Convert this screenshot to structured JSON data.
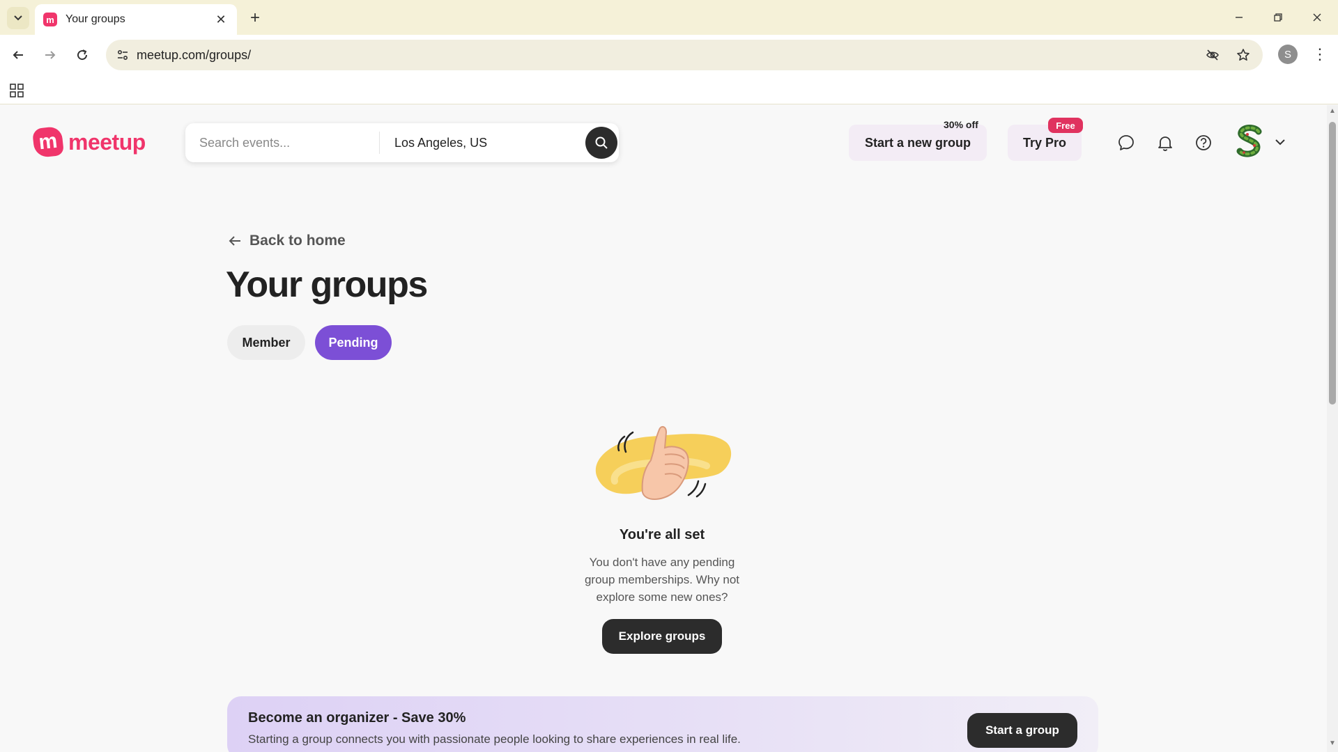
{
  "browser": {
    "tab_title": "Your groups",
    "favicon_letter": "m",
    "url": "meetup.com/groups/",
    "profile_initial": "S"
  },
  "header": {
    "logo_text": "meetup",
    "logo_letter": "m",
    "search_placeholder": "Search events...",
    "location_value": "Los Angeles, US",
    "start_new_group_label": "Start a new group",
    "discount_badge": "30% off",
    "try_pro_label": "Try Pro",
    "free_badge": "Free",
    "brand_color": "#f0356b"
  },
  "main": {
    "back_label": "Back to home",
    "title": "Your groups",
    "tabs": [
      {
        "label": "Member",
        "active": false
      },
      {
        "label": "Pending",
        "active": true
      }
    ],
    "accent_color": "#7c4fd6",
    "empty_state": {
      "title": "You're all set",
      "body": "You don't have any pending group memberships. Why not explore some new ones?",
      "cta": "Explore groups"
    }
  },
  "promo": {
    "title": "Become an organizer - Save 30%",
    "body": "Starting a group connects you with passionate people looking to share experiences in real life.",
    "cta": "Start a group"
  }
}
